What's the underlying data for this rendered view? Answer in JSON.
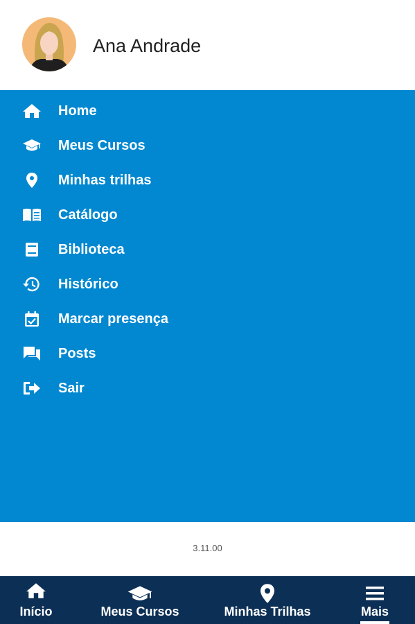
{
  "profile": {
    "name": "Ana Andrade"
  },
  "menu": {
    "items": [
      {
        "label": "Home",
        "icon": "home-icon"
      },
      {
        "label": "Meus Cursos",
        "icon": "graduation-cap-icon"
      },
      {
        "label": "Minhas trilhas",
        "icon": "map-pin-icon"
      },
      {
        "label": "Catálogo",
        "icon": "open-book-icon"
      },
      {
        "label": "Biblioteca",
        "icon": "book-icon"
      },
      {
        "label": "Histórico",
        "icon": "history-icon"
      },
      {
        "label": "Marcar presença",
        "icon": "calendar-check-icon"
      },
      {
        "label": "Posts",
        "icon": "chat-bubbles-icon"
      },
      {
        "label": "Sair",
        "icon": "logout-icon"
      }
    ]
  },
  "version": "3.11.00",
  "bottom_nav": {
    "items": [
      {
        "label": "Início",
        "icon": "home-icon"
      },
      {
        "label": "Meus Cursos",
        "icon": "graduation-cap-icon"
      },
      {
        "label": "Minhas Trilhas",
        "icon": "map-pin-icon"
      },
      {
        "label": "Mais",
        "icon": "hamburger-menu-icon",
        "active": true
      }
    ]
  },
  "colors": {
    "menu_background": "#0288d1",
    "bottom_nav_background": "#0c2f55",
    "avatar_background": "#f5b977",
    "text_on_blue": "#ffffff"
  }
}
